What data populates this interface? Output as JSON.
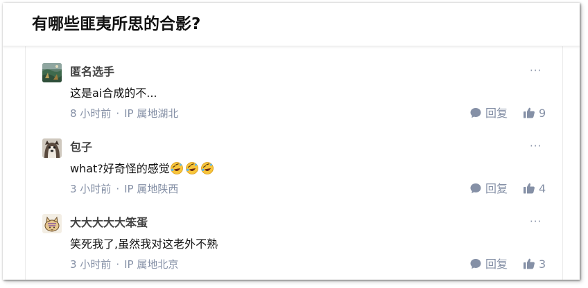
{
  "question": {
    "title": "有哪些匪夷所思的合影?"
  },
  "comments": [
    {
      "author": "匿名选手",
      "content": "这是ai合成的不...",
      "time": "8 小时前",
      "location": "IP 属地湖北",
      "reply_label": "回复",
      "likes": "9",
      "avatar": "landscape-painting-avatar",
      "emoji_count": 0
    },
    {
      "author": "包子",
      "content": "what?好奇怪的感觉",
      "time": "3 小时前",
      "location": "IP 属地陕西",
      "reply_label": "回复",
      "likes": "4",
      "avatar": "dog-photo-avatar",
      "emoji_count": 3
    },
    {
      "author": "大大大大大笨蛋",
      "content": "笑死我了,虽然我对这老外不熟",
      "time": "3 小时前",
      "location": "IP 属地北京",
      "reply_label": "回复",
      "likes": "3",
      "avatar": "cartoon-cat-avatar",
      "emoji_count": 0
    }
  ],
  "ui": {
    "separator": "·",
    "more_label": "···",
    "meta_color": "#8590a6",
    "emoji": "rolling-on-floor-laughing-emoji"
  }
}
